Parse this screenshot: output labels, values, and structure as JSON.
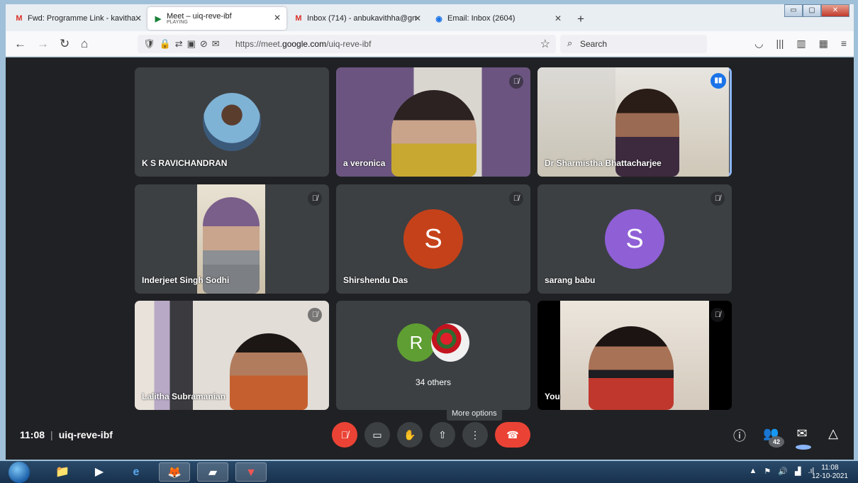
{
  "browser": {
    "tabs": [
      {
        "label": "Fwd: Programme Link - kavitha",
        "icon": "gmail-icon"
      },
      {
        "label": "Meet – uiq-reve-ibf",
        "sub": "PLAYING",
        "icon": "meet-icon"
      },
      {
        "label": "Inbox (714) - anbukavithha@gn",
        "icon": "gmail-icon"
      },
      {
        "label": "Email: Inbox (2604)",
        "icon": "email-icon"
      }
    ],
    "url_prefix": "https://meet.",
    "url_domain": "google.com",
    "url_path": "/uiq-reve-ibf",
    "search_placeholder": "Search"
  },
  "meet": {
    "tiles": [
      {
        "name": "K S RAVICHANDRAN"
      },
      {
        "name": "a veronica"
      },
      {
        "name": "Dr Sharmistha Bhattacharjee"
      },
      {
        "name": "Inderjeet Singh Sodhi"
      },
      {
        "name": "Shirshendu Das",
        "letter": "S",
        "color": "#c5411a"
      },
      {
        "name": "sarang babu",
        "letter": "S",
        "color": "#8f5fd6"
      },
      {
        "name": "Lalitha Subramanian"
      },
      {
        "others_label": "34 others",
        "letter": "R",
        "color": "#5f9e32"
      },
      {
        "name": "You"
      }
    ],
    "tooltip": "More options",
    "time": "11:08",
    "meeting_code": "uiq-reve-ibf",
    "participants_count": "42"
  },
  "taskbar": {
    "clock_time": "11:08",
    "clock_date": "12-10-2021"
  }
}
